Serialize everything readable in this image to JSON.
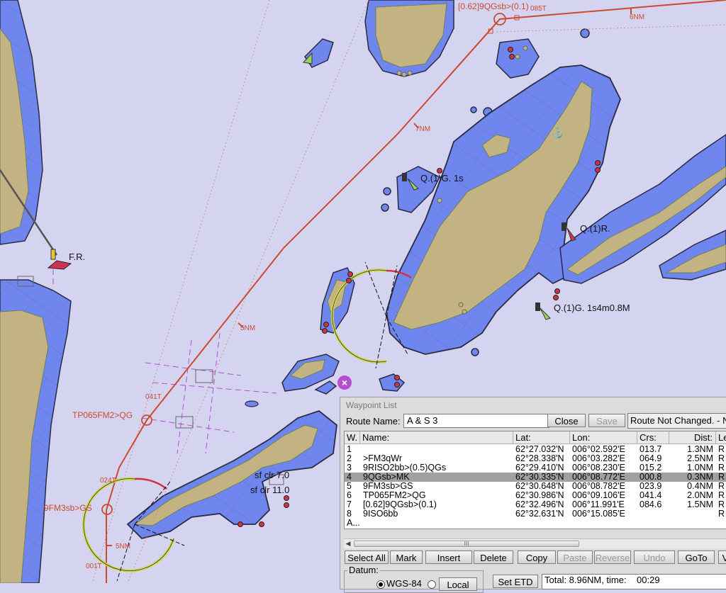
{
  "map": {
    "labels": {
      "route_label_top": "[0.62]9QGsb>(0.1)",
      "course_085": "085T",
      "dist_6nm": "6NM",
      "dist_7nm": "7NM",
      "dist_5nm_mid": "5NM",
      "course_041": "041T",
      "wp_tp065": "TP065FM2>QG",
      "course_024": "024T",
      "wp_9fm3": "9FM3sb>GS",
      "dist_5nm_low": "5NM",
      "course_001": "001T",
      "light_q1g_1s": "Q.(1)G. 1s",
      "light_q1r": "Q.(1)R.",
      "light_q1g_4m": "Q.(1)G. 1s4m0.8M",
      "light_fr": "F.R.",
      "light_sfclr7": "sf clr  7.0",
      "light_sfclr11": "sf clr 11.0"
    },
    "colors": {
      "sea": "#d4d4f0",
      "shallow": "#6f86ee",
      "land": "#c3b382",
      "route": "#cc4a2e"
    }
  },
  "waypoint_list": {
    "title": "Waypoint List",
    "route_name_label": "Route Name:",
    "route_name": "A & S 3",
    "close_label": "Close",
    "save_label": "Save",
    "status": "Route Not Changed. - No",
    "columns": {
      "w": "W.",
      "name": "Name:",
      "lat": "Lat:",
      "lon": "Lon:",
      "crs": "Crs:",
      "dist": "Dist:",
      "le": "Le"
    },
    "rows": [
      {
        "w": "1",
        "name": "",
        "lat": "62°27.032'N",
        "lon": "006°02.592'E",
        "crs": "013.7",
        "dist": "1.3NM",
        "le": "R"
      },
      {
        "w": "2",
        "name": ">FM3qWr",
        "lat": "62°28.338'N",
        "lon": "006°03.282'E",
        "crs": "064.9",
        "dist": "2.5NM",
        "le": "R"
      },
      {
        "w": "3",
        "name": "9RISO2bb>(0.5)QGs",
        "lat": "62°29.410'N",
        "lon": "006°08.230'E",
        "crs": "015.2",
        "dist": "1.0NM",
        "le": "R"
      },
      {
        "w": "4",
        "name": "9QGsb>MK",
        "lat": "62°30.335'N",
        "lon": "006°08.772'E",
        "crs": "000.8",
        "dist": "0.3NM",
        "le": "R"
      },
      {
        "w": "5",
        "name": "9FM3sb>GS",
        "lat": "62°30.648'N",
        "lon": "006°08.782'E",
        "crs": "023.9",
        "dist": "0.4NM",
        "le": "R"
      },
      {
        "w": "6",
        "name": "TP065FM2>QG",
        "lat": "62°30.986'N",
        "lon": "006°09.106'E",
        "crs": "041.4",
        "dist": "2.0NM",
        "le": "R"
      },
      {
        "w": "7",
        "name": "[0.62]9QGsb>(0.1)",
        "lat": "62°32.496'N",
        "lon": "006°11.991'E",
        "crs": "084.6",
        "dist": "1.5NM",
        "le": "R"
      },
      {
        "w": "8",
        "name": "9ISO6bb",
        "lat": "62°32.631'N",
        "lon": "006°15.085'E",
        "crs": "",
        "dist": "",
        "le": "R"
      }
    ],
    "extra_row": "A...",
    "buttons": {
      "select_all": "Select All",
      "mark": "Mark",
      "insert": "Insert",
      "delete": "Delete",
      "copy": "Copy",
      "paste": "Paste",
      "reverse": "Reverse",
      "undo": "Undo",
      "goto": "GoTo",
      "more": "V"
    },
    "datum_label": "Datum:",
    "datum_wgs": "WGS-84",
    "datum_local": "Local",
    "set_etd": "Set ETD",
    "total": "Total: 8.96NM, time:    00:29"
  }
}
